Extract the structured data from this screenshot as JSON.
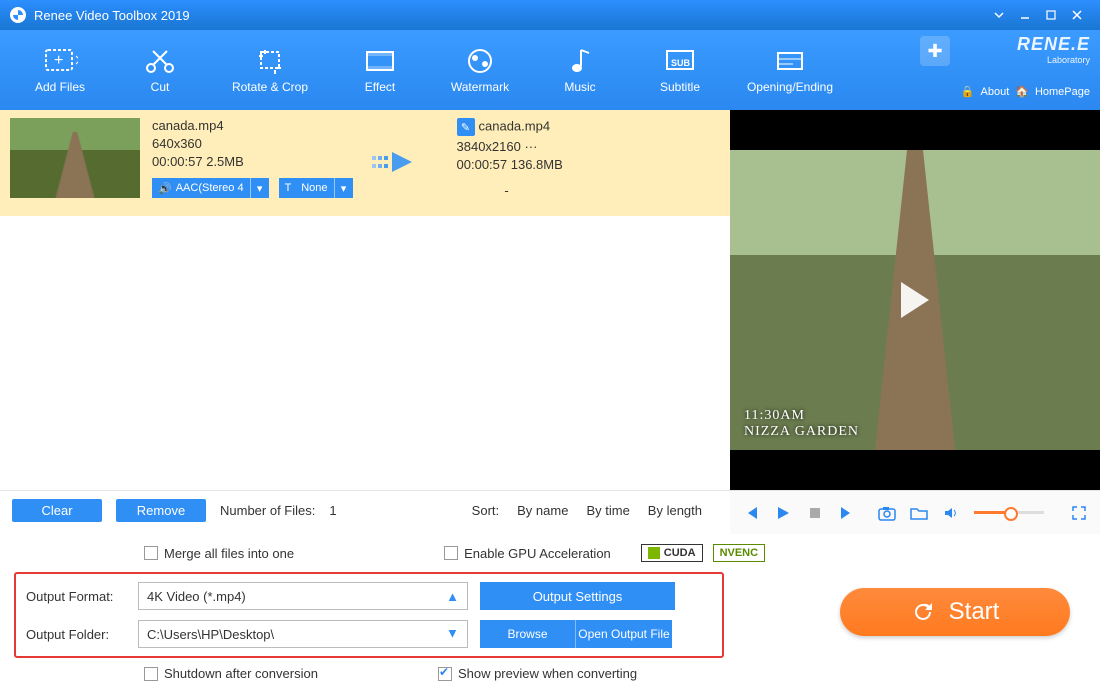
{
  "titlebar": {
    "title": "Renee Video Toolbox 2019"
  },
  "toolbar": {
    "items": [
      {
        "label": "Add Files"
      },
      {
        "label": "Cut"
      },
      {
        "label": "Rotate & Crop"
      },
      {
        "label": "Effect"
      },
      {
        "label": "Watermark"
      },
      {
        "label": "Music"
      },
      {
        "label": "Subtitle"
      },
      {
        "label": "Opening/Ending"
      }
    ],
    "brand_main": "RENE.E",
    "brand_sub": "Laboratory",
    "about": "About",
    "homepage": "HomePage"
  },
  "file": {
    "in_name": "canada.mp4",
    "in_res": "640x360",
    "in_time_size": "00:00:57  2.5MB",
    "out_name": "canada.mp4",
    "out_res": "3840x2160   ···",
    "out_time_size": "00:00:57  136.8MB",
    "audio_chip": "AAC(Stereo 4",
    "text_chip": "None",
    "dash": "-"
  },
  "preview": {
    "overlay_time": "11:30AM",
    "overlay_place": "NIZZA GARDEN"
  },
  "listcontrols": {
    "clear": "Clear",
    "remove": "Remove",
    "filecount_label": "Number of Files:",
    "filecount_value": "1",
    "sort_label": "Sort:",
    "sort_byname": "By name",
    "sort_bytime": "By time",
    "sort_bylength": "By length"
  },
  "bottom": {
    "merge": "Merge all files into one",
    "gpu": "Enable GPU Acceleration",
    "cuda": "CUDA",
    "nvenc": "NVENC",
    "format_label": "Output Format:",
    "format_value": "4K Video (*.mp4)",
    "output_settings": "Output Settings",
    "folder_label": "Output Folder:",
    "folder_value": "C:\\Users\\HP\\Desktop\\",
    "browse": "Browse",
    "open_output": "Open Output File",
    "shutdown": "Shutdown after conversion",
    "show_preview": "Show preview when converting",
    "start": "Start"
  }
}
